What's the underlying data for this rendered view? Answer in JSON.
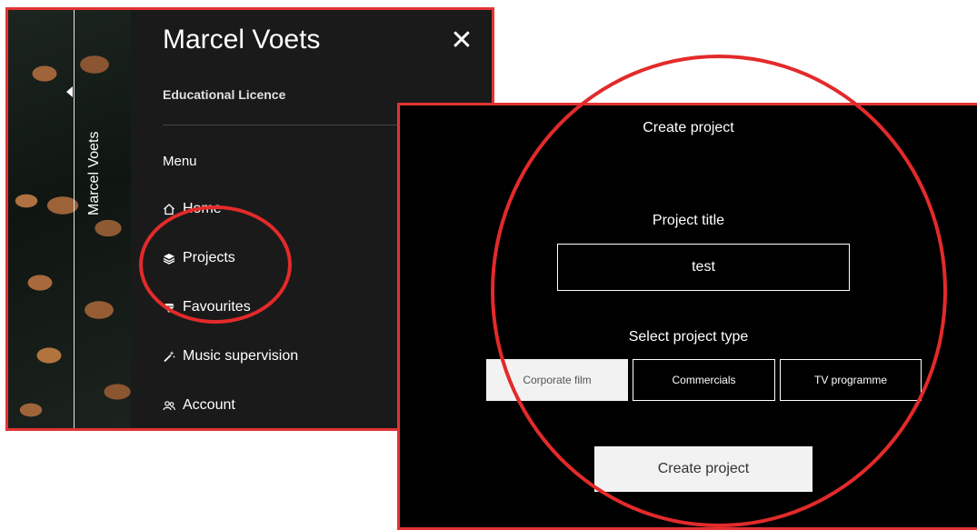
{
  "sidebar": {
    "vertical_name": "Marcel Voets"
  },
  "menu": {
    "user_name": "Marcel Voets",
    "licence": "Educational Licence",
    "section_label": "Menu",
    "close_glyph": "✕",
    "items": [
      {
        "label": "Home",
        "icon": "home-icon"
      },
      {
        "label": "Projects",
        "icon": "layers-icon"
      },
      {
        "label": "Favourites",
        "icon": "diamond-icon"
      },
      {
        "label": "Music supervision",
        "icon": "magic-wand-icon"
      },
      {
        "label": "Account",
        "icon": "users-icon"
      }
    ]
  },
  "create": {
    "heading": "Create project",
    "title_label": "Project title",
    "title_value": "test",
    "type_label": "Select project type",
    "types": [
      {
        "label": "Corporate film",
        "selected": true
      },
      {
        "label": "Commercials",
        "selected": false
      },
      {
        "label": "TV programme",
        "selected": false
      }
    ],
    "submit_label": "Create project"
  },
  "colors": {
    "annotation_red": "#e32a2a",
    "menu_bg": "#1a1a1a",
    "dialog_bg": "#000000",
    "selected_bg": "#f2f2f2"
  }
}
